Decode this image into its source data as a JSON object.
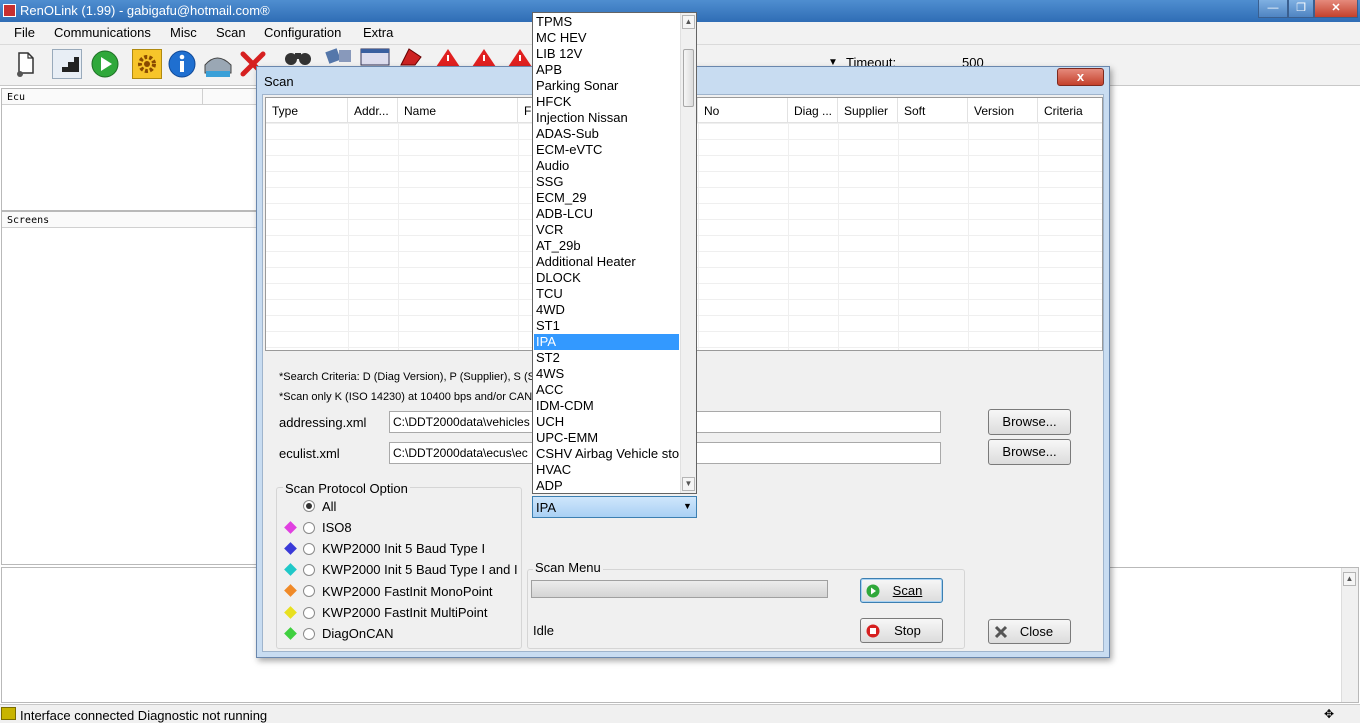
{
  "window": {
    "title": "RenOLink (1.99) - gabigafu@hotmail.com®"
  },
  "menu": [
    "File",
    "Communications",
    "Misc",
    "Scan",
    "Configuration",
    "Extra"
  ],
  "toolbar": {
    "timeout_label": "Timeout:",
    "timeout_value": "500",
    "icons": [
      "new-document-icon",
      "stairs-icon",
      "play-icon",
      "gear-icon",
      "info-icon",
      "scanner-icon",
      "stop-x-icon",
      "binoculars-icon",
      "network-icon",
      "window-icon",
      "red-tag-icon",
      "warning-icon",
      "warning-icon",
      "warning-icon"
    ]
  },
  "left_panes": {
    "ecu_header": "Ecu",
    "screens_header": "Screens"
  },
  "statusbar": {
    "text": "Interface connected Diagnostic not running"
  },
  "dialog": {
    "title": "Scan",
    "close_label": "x",
    "columns": [
      "Type",
      "Addr...",
      "Name",
      "Fi",
      "No",
      "Diag ...",
      "Supplier",
      "Soft",
      "Version",
      "Criteria"
    ],
    "note1": "*Search Criteria: D (Diag Version), P (Supplier), S (Sc",
    "note2": "*Scan only K (ISO 14230) at 10400 bps and/or CAN a",
    "addressing_label": "addressing.xml",
    "addressing_value": "C:\\DDT2000data\\vehicles",
    "eculist_label": "eculist.xml",
    "eculist_value": "C:\\DDT2000data\\ecus\\ec",
    "browse_label": "Browse...",
    "protocol_group": "Scan Protocol Option",
    "protocols": [
      {
        "label": "All",
        "color": "",
        "selected": true
      },
      {
        "label": "ISO8",
        "color": "#e040e0",
        "selected": false
      },
      {
        "label": "KWP2000 Init 5 Baud Type I",
        "color": "#3a3ad8",
        "selected": false
      },
      {
        "label": "KWP2000 Init 5 Baud Type I and II",
        "color": "#20c8c8",
        "selected": false
      },
      {
        "label": "KWP2000 FastInit MonoPoint",
        "color": "#f08a28",
        "selected": false
      },
      {
        "label": "KWP2000 FastInit MultiPoint",
        "color": "#e8e020",
        "selected": false
      },
      {
        "label": "DiagOnCAN",
        "color": "#40d040",
        "selected": false
      }
    ],
    "scan_menu_label": "Scan Menu",
    "status": "Idle",
    "progress": 0,
    "scan_button": "Scan",
    "stop_button": "Stop",
    "close_button": "Close",
    "combo_value": "IPA"
  },
  "dropdown": {
    "options": [
      "TPMS",
      "MC HEV",
      "LIB 12V",
      "APB",
      "Parking Sonar",
      "HFCK",
      "Injection Nissan",
      "ADAS-Sub",
      "ECM-eVTC",
      "Audio",
      "SSG",
      "ECM_29",
      "ADB-LCU",
      "VCR",
      "AT_29b",
      "Additional Heater",
      "DLOCK",
      "TCU",
      "4WD",
      "ST1",
      "IPA",
      "ST2",
      "4WS",
      "ACC",
      "IDM-CDM",
      "UCH",
      "UPC-EMM",
      "CSHV Airbag Vehicle sto",
      "HVAC",
      "ADP"
    ],
    "selected": "IPA"
  },
  "colors": {
    "accent": "#3399ff",
    "dialog_frame": "#c8dcf1",
    "title_bar": "#2f6db5"
  }
}
